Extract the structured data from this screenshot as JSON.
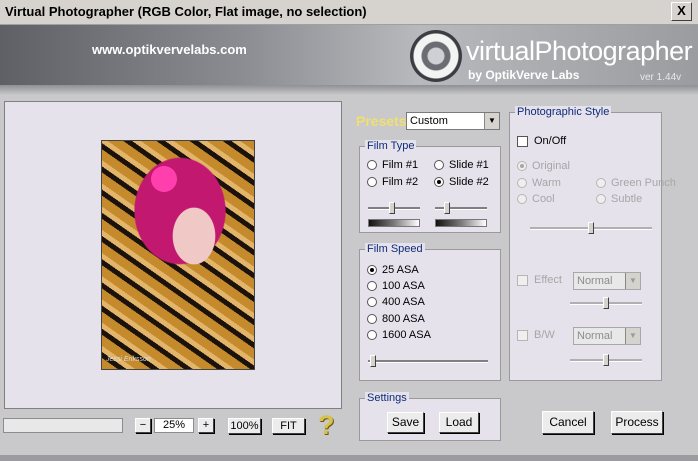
{
  "window": {
    "title": "Virtual Photographer (RGB Color, Flat image, no selection)",
    "close_label": "X"
  },
  "header": {
    "url": "www.optikvervelabs.com",
    "logo_main": "virtualPhotographer",
    "logo_sub": "by OptikVerve Labs",
    "version": "ver 1.44v"
  },
  "presets": {
    "label": "Presets",
    "value": "Custom"
  },
  "film_type": {
    "label": "Film Type",
    "options": [
      {
        "label": "Film #1",
        "selected": false
      },
      {
        "label": "Slide #1",
        "selected": false
      },
      {
        "label": "Film #2",
        "selected": false
      },
      {
        "label": "Slide #2",
        "selected": true
      }
    ],
    "film_slider_level": 0.45,
    "slide_slider_level": 0.2
  },
  "film_speed": {
    "label": "Film Speed",
    "options": [
      {
        "label": "25 ASA",
        "selected": true
      },
      {
        "label": "100 ASA",
        "selected": false
      },
      {
        "label": "400 ASA",
        "selected": false
      },
      {
        "label": "800 ASA",
        "selected": false
      },
      {
        "label": "1600 ASA",
        "selected": false
      }
    ],
    "slider_level": 0.02
  },
  "settings": {
    "label": "Settings",
    "save_label": "Save",
    "load_label": "Load"
  },
  "photographic_style": {
    "label": "Photographic Style",
    "onoff_label": "On/Off",
    "styles": [
      {
        "label": "Original",
        "selected": true
      },
      {
        "label": "Warm",
        "selected": false
      },
      {
        "label": "Green Punch",
        "selected": false
      },
      {
        "label": "Cool",
        "selected": false
      },
      {
        "label": "Subtle",
        "selected": false
      }
    ],
    "style_slider_level": 0.5,
    "effect_label": "Effect",
    "effect_value": "Normal",
    "effect_slider_level": 0.5,
    "bw_label": "B/W",
    "bw_value": "Normal",
    "bw_slider_level": 0.5
  },
  "zoom": {
    "minus_label": "−",
    "value": "25%",
    "plus_label": "+",
    "full_label": "100%",
    "fit_label": "FIT"
  },
  "help": {
    "label": "?"
  },
  "photo": {
    "signature": "Jessi Eriksson"
  },
  "actions": {
    "cancel_label": "Cancel",
    "process_label": "Process"
  },
  "progress": {
    "level": 0
  },
  "colors": {
    "panel": "#e6e2eb",
    "group_label": "#0d2b7a",
    "presets_label": "#f0e070",
    "help": "#d6c14a"
  }
}
